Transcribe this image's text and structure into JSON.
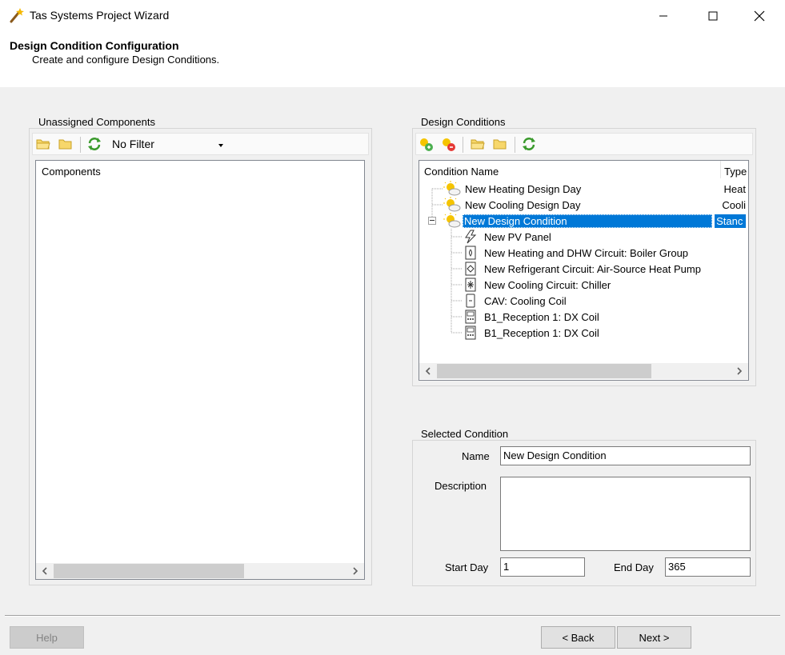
{
  "window": {
    "title": "Tas Systems Project Wizard"
  },
  "header": {
    "title": "Design Condition Configuration",
    "subtitle": "Create and configure Design Conditions."
  },
  "unassigned": {
    "group_label": "Unassigned Components",
    "filter_value": "No Filter",
    "column_header": "Components"
  },
  "conditions": {
    "group_label": "Design Conditions",
    "col_name": "Condition Name",
    "col_type": "Type",
    "items": [
      {
        "name": "New Heating Design Day",
        "type": "Heat"
      },
      {
        "name": "New Cooling Design Day",
        "type": "Cooli"
      },
      {
        "name": "New Design Condition",
        "type": "Stanc"
      }
    ],
    "children": [
      {
        "name": "New PV Panel",
        "icon": "pv-panel-icon"
      },
      {
        "name": "New Heating and DHW Circuit: Boiler Group",
        "icon": "boiler-icon"
      },
      {
        "name": "New Refrigerant Circuit: Air-Source Heat Pump",
        "icon": "heat-pump-icon"
      },
      {
        "name": "New Cooling Circuit: Chiller",
        "icon": "chiller-icon"
      },
      {
        "name": "CAV: Cooling Coil",
        "icon": "cooling-coil-icon"
      },
      {
        "name": "B1_Reception 1: DX Coil",
        "icon": "dx-coil-icon"
      },
      {
        "name": "B1_Reception 1: DX Coil",
        "icon": "dx-coil-icon"
      }
    ]
  },
  "selected": {
    "group_label": "Selected Condition",
    "name_label": "Name",
    "name_value": "New Design Condition",
    "description_label": "Description",
    "description_value": "",
    "start_day_label": "Start Day",
    "start_day_value": "1",
    "end_day_label": "End Day",
    "end_day_value": "365"
  },
  "buttons": {
    "help": "Help",
    "back": "< Back",
    "next": "Next >"
  },
  "colors": {
    "selection": "#0078d7"
  }
}
